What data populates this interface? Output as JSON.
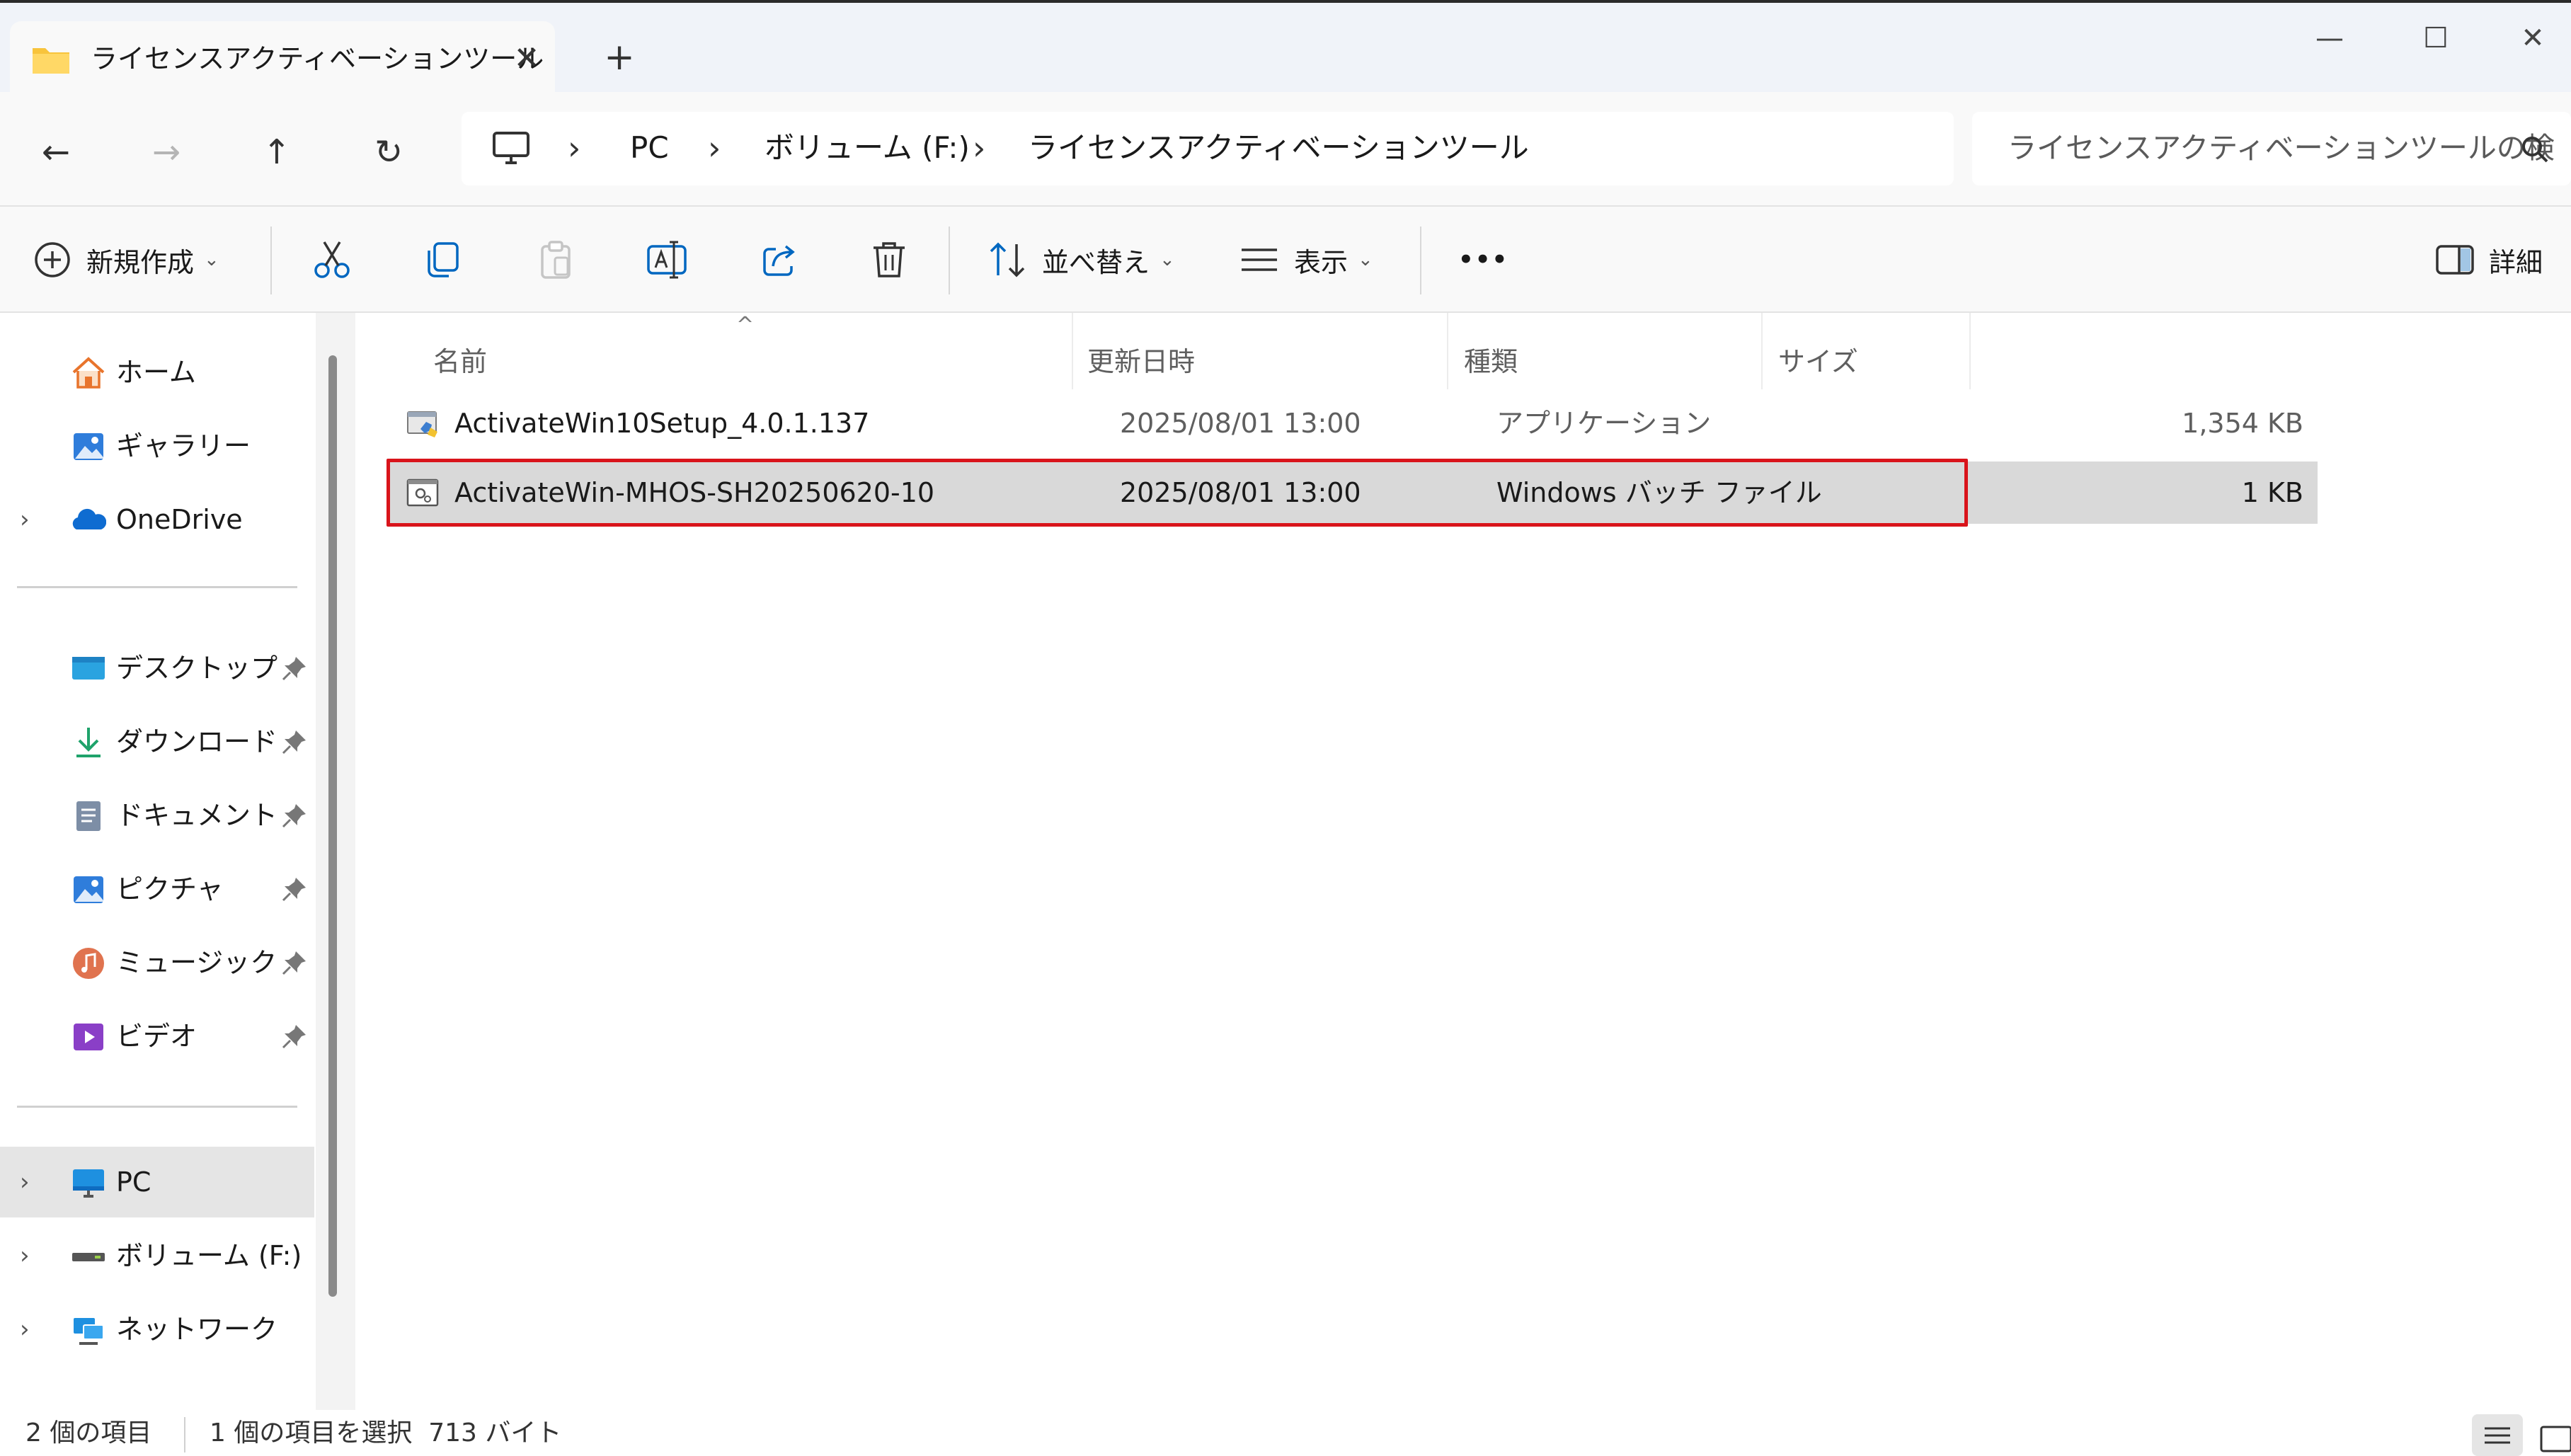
{
  "window": {
    "tab_title": "ライセンスアクティベーションツール",
    "tab_close": "✕",
    "new_tab": "+",
    "minimize": "—",
    "maximize": "☐",
    "close": "✕"
  },
  "nav": {
    "back": "←",
    "forward": "→",
    "up": "↑",
    "refresh": "↻",
    "breadcrumb": [
      "PC",
      "ボリューム (F:)",
      "ライセンスアクティベーションツール"
    ],
    "separator": "›",
    "search_placeholder": "ライセンスアクティベーションツールの検"
  },
  "toolbar": {
    "new_label": "新規作成",
    "sort_label": "並べ替え",
    "view_label": "表示",
    "more_label": "•••",
    "details_label": "詳細",
    "chevron": "⌄"
  },
  "sidebar": {
    "quick": [
      {
        "label": "ホーム",
        "icon": "home-icon"
      },
      {
        "label": "ギャラリー",
        "icon": "gallery-icon"
      },
      {
        "label": "OneDrive",
        "icon": "onedrive-icon",
        "expandable": true
      }
    ],
    "pinned": [
      {
        "label": "デスクトップ",
        "icon": "desktop-icon"
      },
      {
        "label": "ダウンロード",
        "icon": "download-icon"
      },
      {
        "label": "ドキュメント",
        "icon": "documents-icon"
      },
      {
        "label": "ピクチャ",
        "icon": "pictures-icon"
      },
      {
        "label": "ミュージック",
        "icon": "music-icon"
      },
      {
        "label": "ビデオ",
        "icon": "videos-icon"
      }
    ],
    "devices": [
      {
        "label": "PC",
        "icon": "pc-icon",
        "selected": true
      },
      {
        "label": "ボリューム (F:)",
        "icon": "drive-icon"
      },
      {
        "label": "ネットワーク",
        "icon": "network-icon"
      }
    ],
    "expander": "›"
  },
  "columns": {
    "name": "名前",
    "modified": "更新日時",
    "type": "種類",
    "size": "サイズ",
    "sort_indicator": "^"
  },
  "files": [
    {
      "name": "ActivateWin10Setup_4.0.1.137",
      "modified": "2025/08/01 13:00",
      "type": "アプリケーション",
      "size": "1,354 KB",
      "icon": "application-icon",
      "selected": false
    },
    {
      "name": "ActivateWin-MHOS-SH20250620-10",
      "modified": "2025/08/01 13:00",
      "type": "Windows バッチ ファイル",
      "size": "1 KB",
      "icon": "batch-file-icon",
      "selected": true
    }
  ],
  "status": {
    "item_count": "2 個の項目",
    "selection": "1 個の項目を選択  713 バイト"
  },
  "colors": {
    "highlight": "#d9141b",
    "selection": "#d9d9d9",
    "accent": "#0067c0"
  }
}
